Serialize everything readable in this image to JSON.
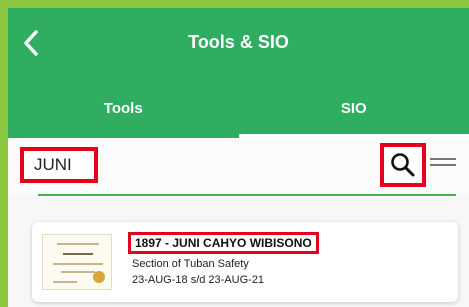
{
  "header": {
    "title": "Tools & SIO"
  },
  "tabs": [
    {
      "label": "Tools",
      "active": false
    },
    {
      "label": "SIO",
      "active": true
    }
  ],
  "search": {
    "value": "JUNI"
  },
  "icons": {
    "back": "chevron-left-icon",
    "search": "search-icon",
    "menu": "hamburger-menu-icon"
  },
  "results": [
    {
      "title": "1897 - JUNI CAHYO WIBISONO",
      "subtitle": "Section of Tuban Safety",
      "date_range": "23-AUG-18 s/d 23-AUG-21"
    }
  ],
  "colors": {
    "primary": "#2fae62",
    "highlight": "#e3001b",
    "frame": "#8dc63f"
  }
}
